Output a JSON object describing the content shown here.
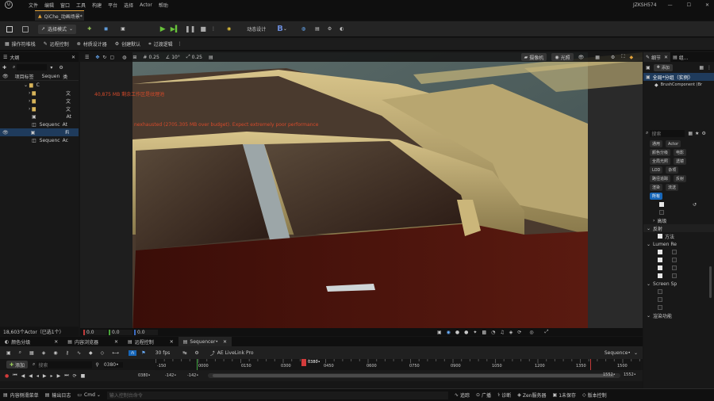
{
  "menu": {
    "items": [
      "文件",
      "编辑",
      "窗口",
      "工具",
      "构建",
      "平台",
      "选择",
      "Actor",
      "帮助"
    ],
    "account": "JZKSH574"
  },
  "doc_tab": {
    "label": "QiChe_动画场景*"
  },
  "toolbar": {
    "save_label": "",
    "mode_label": "选择模式",
    "dynamic_label": "动态设计",
    "build_label": "B"
  },
  "subbar": {
    "items": [
      "操作符堆栈",
      "远程控制",
      "材质设计器",
      "创建默认",
      "过渡逻辑"
    ]
  },
  "outliner": {
    "tab": "大纲",
    "header_label": "项目标签",
    "header_col": "Sequen",
    "header_col2": "类",
    "rows": [
      {
        "label": "C",
        "type": ""
      },
      {
        "label": "",
        "type": "文"
      },
      {
        "label": "",
        "type": "文"
      },
      {
        "label": "",
        "type": "文"
      },
      {
        "label": "",
        "type": "At"
      },
      {
        "label": "Sequenc",
        "type": "At"
      },
      {
        "label": "",
        "type": "Fi"
      },
      {
        "label": "Sequenc",
        "type": "Ac"
      }
    ],
    "footer": "18,603个Actor（已选1个）"
  },
  "viewport": {
    "speed": "0.25",
    "angle": "10°",
    "scale": "0.25",
    "camera_label": "摄像机",
    "lit_label": "光照",
    "warning1": "40,875 MB 剩余工作区是纹理池",
    "warning2": "nexhausted (2705.305 MB over budget). Expect extremely poor performance",
    "coord_x": "0.0",
    "coord_y": "0.0",
    "coord_z": "0.0"
  },
  "details": {
    "tab1": "细节",
    "tab2": "组...",
    "add_label": "添加",
    "selected_item": "全局*分组（实例）",
    "component": "BrushComponent (Br",
    "search_placeholder": "搜索",
    "filters": [
      [
        "通用",
        "Actor"
      ],
      [
        "颜色分级",
        "电影"
      ],
      [
        "全局光照",
        "透镜"
      ],
      [
        "LOD",
        "杂项"
      ],
      [
        "路径追踪",
        "反射"
      ],
      [
        "渲染",
        "流送"
      ]
    ],
    "all_label": "所有",
    "section_advanced": "高级",
    "section_reflection": "反射",
    "method_label": "方法",
    "lumen_label": "Lumen Re",
    "screen_label": "Screen Sp",
    "render_label": "渲染功能"
  },
  "bottom_tabs": [
    {
      "label": "颜色分级"
    },
    {
      "label": "内容浏览器"
    },
    {
      "label": "远程控制"
    },
    {
      "label": "Sequencer•"
    }
  ],
  "sequencer": {
    "add_label": "添加",
    "search_placeholder": "搜索",
    "fps": "30 fps",
    "livelink": "AE LiveLink Pro",
    "name": "Sequence•",
    "current_frame": "0380•",
    "ticks": [
      "-150",
      "0000",
      "0150",
      "0300",
      "0450",
      "0600",
      "0750",
      "0900",
      "1050",
      "1200",
      "1350",
      "1500"
    ],
    "start": "0380•",
    "range_start": "-142•",
    "range_end": "-142•",
    "end1": "1552•",
    "end2": "1552•"
  },
  "statusbar": {
    "content_drawer": "内容侧滑菜单",
    "output_log": "输出日志",
    "cmd": "Cmd",
    "cmd_placeholder": "输入控制台命令",
    "trace": "追踪",
    "derived": "广播",
    "diagnostics": "诊断",
    "zen": "Zen服务器",
    "unsaved": "1未保存",
    "source_control": "版本控制"
  },
  "colors": {
    "accent": "#e4a33a",
    "selected": "#1f3b5c",
    "blue_btn": "#1766b8",
    "playhead": "#d23b3b"
  }
}
